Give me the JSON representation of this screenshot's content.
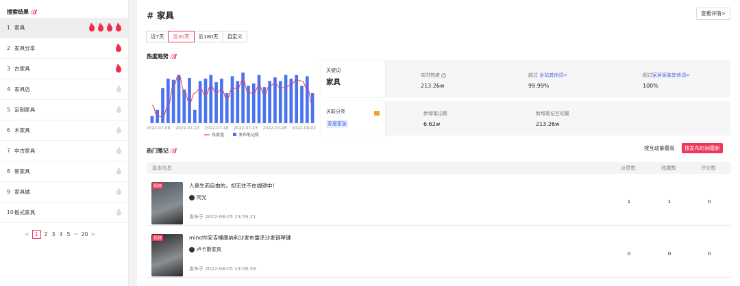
{
  "sidebar": {
    "title": "搜索结果",
    "items": [
      {
        "index": "1",
        "label": "家具",
        "heat": "4 hot",
        "hot": 4
      },
      {
        "index": "2",
        "label": "家具分享",
        "heat": "1 hot",
        "hot": 1
      },
      {
        "index": "3",
        "label": "古家具",
        "heat": "1 hot",
        "hot": 1
      },
      {
        "index": "4",
        "label": "家具店",
        "heat": "cold",
        "hot": 0
      },
      {
        "index": "5",
        "label": "定制家具",
        "heat": "cold",
        "hot": 0
      },
      {
        "index": "6",
        "label": "木家具",
        "heat": "cold",
        "hot": 0
      },
      {
        "index": "7",
        "label": "中古家具",
        "heat": "cold",
        "hot": 0
      },
      {
        "index": "8",
        "label": "新家具",
        "heat": "cold",
        "hot": 0
      },
      {
        "index": "9",
        "label": "家具城",
        "heat": "cold",
        "hot": 0
      },
      {
        "index": "10",
        "label": "板式家具",
        "heat": "cold",
        "hot": 0
      }
    ],
    "pagination": {
      "prev": "<",
      "pages": [
        "1",
        "2",
        "3",
        "4",
        "5"
      ],
      "ellipsis": "···",
      "last": "20",
      "next": ">",
      "current": "1"
    }
  },
  "header": {
    "title": "# 家具",
    "detail_button": "查看详情>"
  },
  "tabs": [
    "近7天",
    "近30天",
    "近180天",
    "自定义"
  ],
  "active_tab": "近30天",
  "heat_section": {
    "title": "热度趋势"
  },
  "keyword_card": {
    "label": "关键词",
    "keyword": "家具",
    "realtime_label": "实时热度",
    "realtime_value": "213.26w",
    "beat_all_prefix": "超过 ",
    "beat_all_link": "全站其他词>",
    "beat_all_value": "99.99%",
    "beat_cat_prefix": "超过",
    "beat_cat_link": "家居家装其他词>",
    "beat_cat_value": "100%"
  },
  "category_card": {
    "label": "关联分类",
    "category": "家居家装",
    "new_notes_label": "新增笔记数",
    "new_notes_value": "6.62w",
    "interactions_label": "新增笔记互动量",
    "interactions_value": "213.26w"
  },
  "notes_section": {
    "title": "热门笔记",
    "sort_interaction": "按互动量最高",
    "sort_recent": "按发布时间最新",
    "columns": {
      "basic": "基本信息",
      "likes": "点赞数",
      "collects": "收藏数",
      "comments": "评论数"
    },
    "rows": [
      {
        "badge": "视频",
        "title": "人是生而自由的，却无往不在枷锁中！",
        "author": "阿光",
        "published": "发布于 2022-08-05 23:59:21",
        "likes": "1",
        "collects": "1",
        "comments": "0",
        "thumb_color": "#4c5a62"
      },
      {
        "badge": "视频",
        "title": "minotti安吉榛康纳利沙发布雷泽沙发钢琴键",
        "author": "卢卡斯家具",
        "published": "发布于 2022-08-05 23:58:58",
        "likes": "0",
        "collects": "0",
        "comments": "0",
        "thumb_color": "#262626"
      }
    ]
  },
  "colors": {
    "accent": "#f0365b",
    "bar": "#4a73f0",
    "line": "#ef3b53",
    "link": "#3f6ad8"
  },
  "chart_data": {
    "type": "bar",
    "title": "",
    "x_tick_labels": [
      "2022-07-08",
      "2022-07-13",
      "2022-07-18",
      "2022-07-23",
      "2022-07-28",
      "2022-08-02"
    ],
    "ylim": [
      0,
      100
    ],
    "grid": false,
    "legend_position": "bottom",
    "series": [
      {
        "name": "发布笔记数",
        "type": "bar",
        "values": [
          12,
          22,
          58,
          74,
          72,
          80,
          56,
          75,
          22,
          70,
          74,
          80,
          68,
          74,
          50,
          78,
          70,
          84,
          62,
          66,
          80,
          60,
          70,
          76,
          70,
          80,
          74,
          80,
          62,
          78,
          50
        ]
      },
      {
        "name": "热度值",
        "type": "line",
        "values": [
          30,
          12,
          10,
          28,
          62,
          80,
          54,
          34,
          50,
          58,
          46,
          62,
          50,
          56,
          40,
          58,
          58,
          72,
          50,
          50,
          62,
          48,
          62,
          66,
          58,
          60,
          64,
          72,
          70,
          58,
          30
        ]
      }
    ]
  }
}
